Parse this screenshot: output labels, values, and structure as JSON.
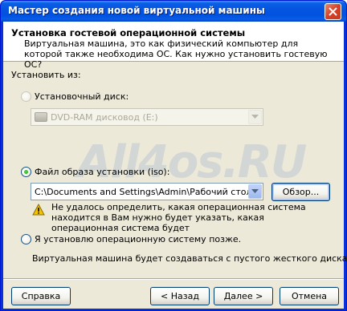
{
  "window": {
    "title": "Мастер создания новой виртуальной машины"
  },
  "header": {
    "title": "Установка гостевой операционной системы",
    "subtitle": "Виртуальная машина, это как физический компьютер для которой также необходима ОС. Как нужно установить гостевую ОС?"
  },
  "install_from_label": "Установить из:",
  "options": {
    "disk": {
      "label": "Установочный диск:",
      "selected": false,
      "enabled": false,
      "combo_value": "DVD-RAM дисковод (E:)"
    },
    "iso": {
      "label": "Файл образа установки (iso):",
      "selected": true,
      "combo_value": "C:\\Documents and Settings\\Admin\\Рабочий стол\\Wir",
      "browse_label": "Обзор..."
    },
    "later": {
      "label": "Я установлю операционную систему позже.",
      "selected": false
    }
  },
  "warning_text": "Не удалось определить, какая операционная система находится в Вам нужно будет указать, какая операционная система будет",
  "later_note": "Виртуальная машина будет создаваться с пустого жесткого диска.",
  "watermark": "All4os.RU",
  "buttons": {
    "help": "Справка",
    "back": "< Назад",
    "next": "Далее >",
    "cancel": "Отмена"
  },
  "colors": {
    "titlebar": "#0a5fe5",
    "dialog_bg": "#ece9d8",
    "warning": "#f5c400"
  },
  "icons": {
    "close": "close-icon",
    "warning": "warning-icon",
    "disk": "dvd-drive-icon",
    "dropdown": "chevron-down-icon"
  }
}
